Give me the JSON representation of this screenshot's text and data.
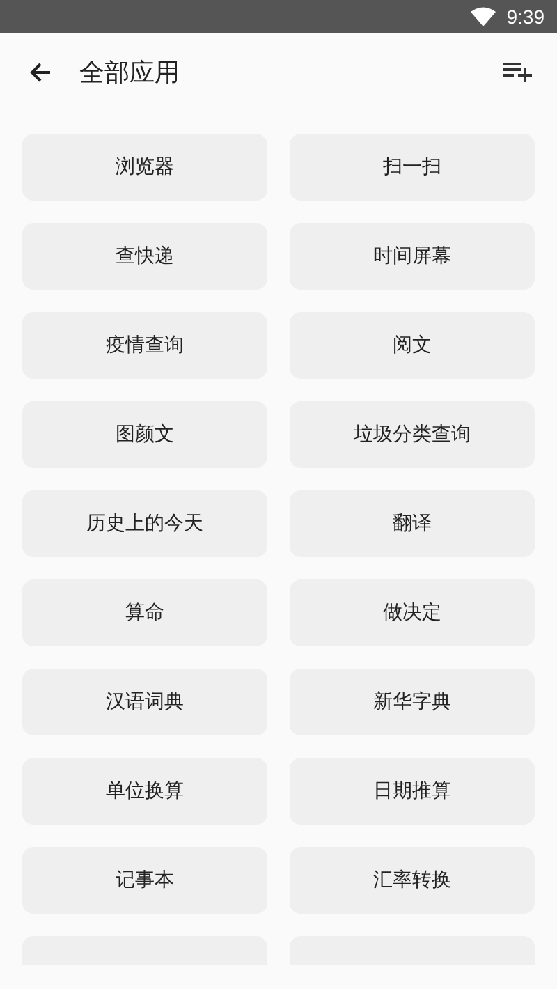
{
  "status_bar": {
    "time": "9:39"
  },
  "header": {
    "title": "全部应用"
  },
  "apps": [
    {
      "label": "浏览器"
    },
    {
      "label": "扫一扫"
    },
    {
      "label": "查快递"
    },
    {
      "label": "时间屏幕"
    },
    {
      "label": "疫情查询"
    },
    {
      "label": "阅文"
    },
    {
      "label": "图颜文"
    },
    {
      "label": "垃圾分类查询"
    },
    {
      "label": "历史上的今天"
    },
    {
      "label": "翻译"
    },
    {
      "label": "算命"
    },
    {
      "label": "做决定"
    },
    {
      "label": "汉语词典"
    },
    {
      "label": "新华字典"
    },
    {
      "label": "单位换算"
    },
    {
      "label": "日期推算"
    },
    {
      "label": "记事本"
    },
    {
      "label": "汇率转换"
    },
    {
      "kind": "cut_off"
    },
    {
      "kind": "cut_off"
    }
  ]
}
